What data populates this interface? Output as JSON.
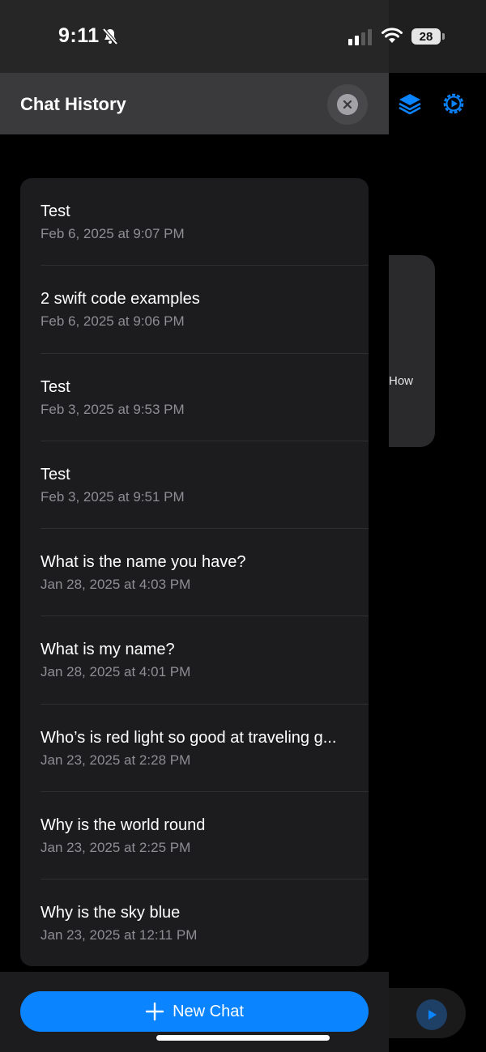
{
  "status_bar": {
    "time": "9:11",
    "battery": "28"
  },
  "header": {
    "title": "Chat History"
  },
  "background_card": {
    "partial_text": "How"
  },
  "history": {
    "items": [
      {
        "title": "Test",
        "date": "Feb 6, 2025 at 9:07 PM"
      },
      {
        "title": "2 swift code examples",
        "date": "Feb 6, 2025 at 9:06 PM"
      },
      {
        "title": "Test",
        "date": "Feb 3, 2025 at 9:53 PM"
      },
      {
        "title": "Test",
        "date": "Feb 3, 2025 at 9:51 PM"
      },
      {
        "title": "What is the name you have?",
        "date": "Jan 28, 2025 at 4:03 PM"
      },
      {
        "title": "What is my name?",
        "date": "Jan 28, 2025 at 4:01 PM"
      },
      {
        "title": "Who’s is red light so good at traveling g...",
        "date": "Jan 23, 2025 at 2:28 PM"
      },
      {
        "title": "Why is the world round",
        "date": "Jan 23, 2025 at 2:25 PM"
      },
      {
        "title": "Why is the sky blue",
        "date": "Jan 23, 2025 at 12:11 PM"
      }
    ]
  },
  "footer": {
    "new_chat_label": "New Chat"
  },
  "icons": {
    "bell": "bell-slash-icon",
    "signal": "cellular-signal-icon",
    "wifi": "wifi-icon",
    "close": "close-icon",
    "layers": "layers-icon",
    "settings": "gear-icon",
    "plus": "plus-icon",
    "send": "play-icon"
  },
  "colors": {
    "accent": "#0a84ff",
    "panel": "#1c1c1e",
    "secondary_text": "#8e8e93"
  }
}
